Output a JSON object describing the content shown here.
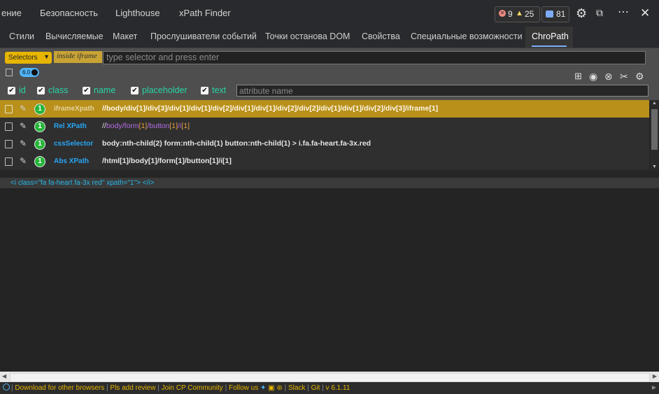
{
  "devtools_tabs": [
    "ение",
    "Безопасность",
    "Lighthouse",
    "xPath Finder"
  ],
  "counters": {
    "errors": "9",
    "warnings": "25",
    "messages": "81"
  },
  "icons": {
    "error": "error-circle-icon",
    "warning": "warning-triangle-icon",
    "message": "message-icon",
    "settings": "gear-icon",
    "dock": "dock-icon",
    "more": "more-icon",
    "close": "close-icon"
  },
  "sub_tabs": [
    "Стили",
    "Вычисляемые",
    "Макет",
    "Прослушиватели событий",
    "Точки останова DOM",
    "Свойства",
    "Специальные возможности",
    "ChroPath"
  ],
  "active_sub_tab": "ChroPath",
  "chropath": {
    "selector_type": "Selectors",
    "iframe_tag": "inside iframe",
    "selector_placeholder": "type selector and press enter",
    "version": "6.0",
    "attributes": [
      {
        "label": "id",
        "checked": true
      },
      {
        "label": "class",
        "checked": true
      },
      {
        "label": "name",
        "checked": true
      },
      {
        "label": "placeholder",
        "checked": true
      },
      {
        "label": "text",
        "checked": true
      }
    ],
    "attribute_placeholder": "attribute name",
    "rows": [
      {
        "type": "iframeXpath",
        "count": "1",
        "value": "//body/div[1]/div[3]/div[1]/div[1]/div[2]/div[1]/div[1]/div[2]/div[2]/div[1]/div[1]/div[2]/div[3]/iframe[1]"
      },
      {
        "type": "Rel XPath",
        "count": "1",
        "value_parts": [
          "//",
          "body",
          "/",
          "form",
          "[1]",
          "/",
          "button",
          "[1]",
          "/",
          "i",
          "[1]"
        ]
      },
      {
        "type": "cssSelector",
        "count": "1",
        "value": "body:nth-child(2) form:nth-child(1) button:nth-child(1) > i.fa.fa-heart.fa-3x.red"
      },
      {
        "type": "Abs XPath",
        "count": "1",
        "value": "/html[1]/body[1]/form[1]/button[1]/i[1]"
      }
    ],
    "element_html": "<i class=\"fa fa-heart fa-3x red\" xpath=\"1\"> </i>"
  },
  "footer": {
    "parts": [
      "Download for other browsers",
      "Pls add review",
      "Join CP Community",
      "Follow us",
      "Slack",
      "Git",
      "v 6.1.11"
    ]
  },
  "colors": {
    "highlight_row": "#b8901a",
    "accent_blue": "#7cacf8",
    "attr_green": "#27d4a4",
    "chropath_yellow": "#e7b500"
  }
}
